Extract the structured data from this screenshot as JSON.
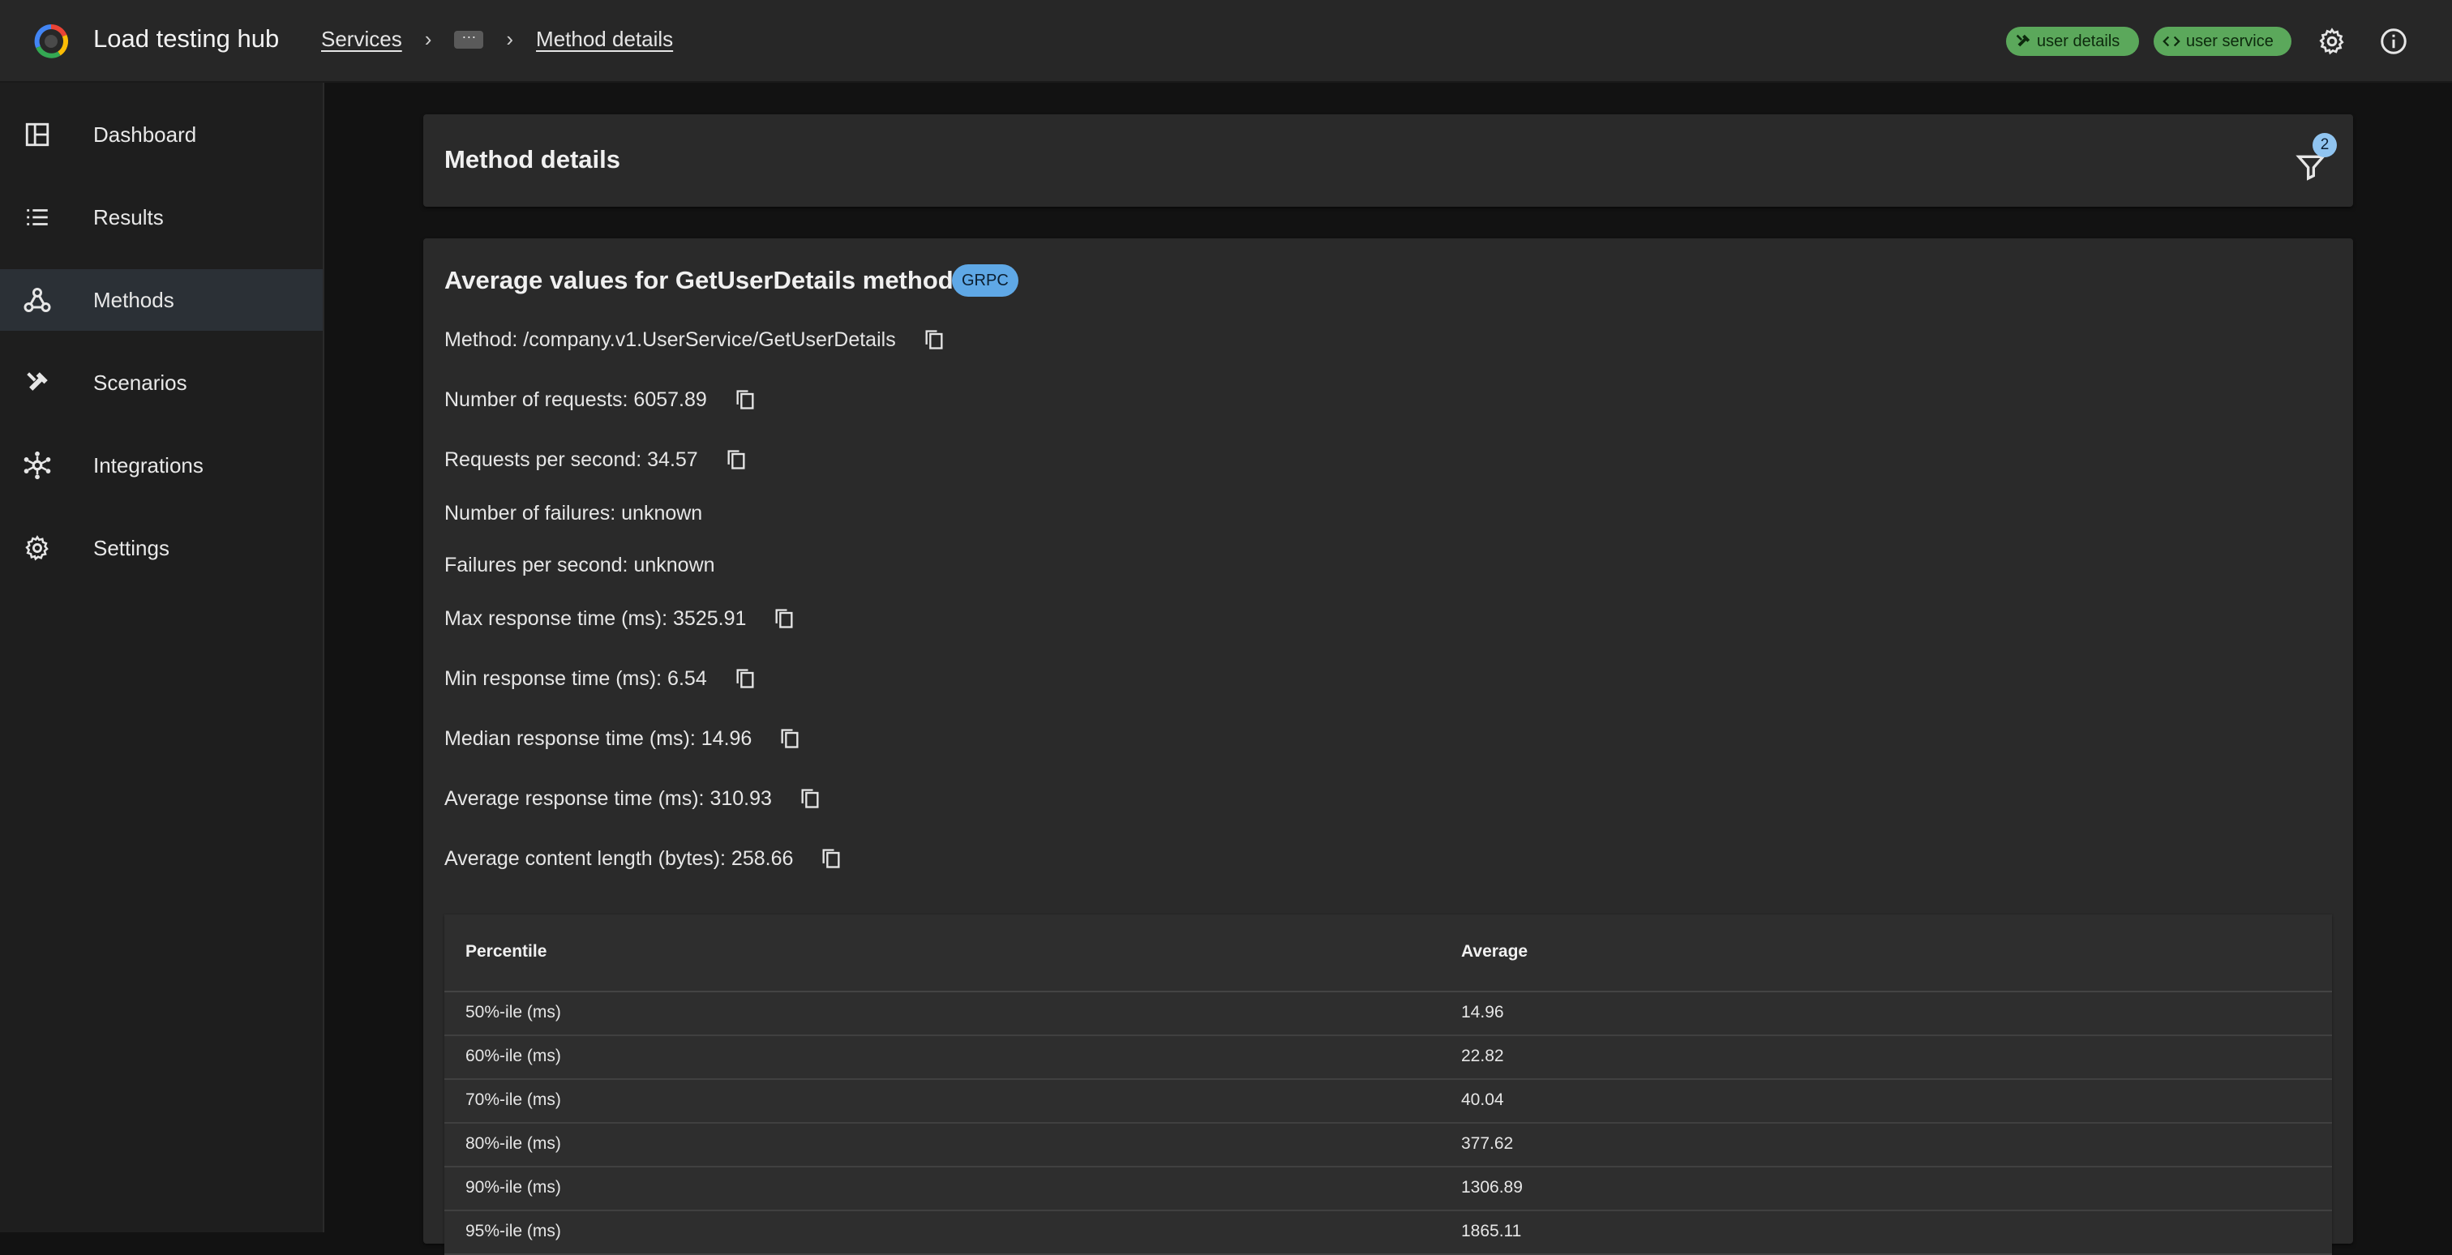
{
  "header": {
    "app_title": "Load testing hub",
    "breadcrumb": {
      "services": "Services",
      "ellipsis": "···",
      "current": "Method details"
    },
    "chips": [
      {
        "label": "user details",
        "icon": "tools-icon"
      },
      {
        "label": "user service",
        "icon": "code-icon"
      }
    ],
    "icons": [
      "gear-icon",
      "info-icon"
    ]
  },
  "sidebar": {
    "items": [
      {
        "label": "Dashboard",
        "icon": "dashboard-icon",
        "active": false
      },
      {
        "label": "Results",
        "icon": "list-icon",
        "active": false
      },
      {
        "label": "Methods",
        "icon": "webhook-icon",
        "active": true
      },
      {
        "label": "Scenarios",
        "icon": "tools-icon",
        "active": false
      },
      {
        "label": "Integrations",
        "icon": "hub-icon",
        "active": false
      },
      {
        "label": "Settings",
        "icon": "gear-icon",
        "active": false
      }
    ]
  },
  "method_details_card": {
    "title": "Method details",
    "filter_count": "2"
  },
  "averages": {
    "title": "Average values for GetUserDetails method",
    "badge": "GRPC",
    "stats": [
      {
        "text": "Method: /company.v1.UserService/GetUserDetails",
        "copy": true
      },
      {
        "text": "Number of requests: 6057.89",
        "copy": true
      },
      {
        "text": "Requests per second: 34.57",
        "copy": true
      },
      {
        "text": "Number of failures: unknown",
        "copy": false
      },
      {
        "text": "Failures per second: unknown",
        "copy": false
      },
      {
        "text": "Max response time (ms): 3525.91",
        "copy": true
      },
      {
        "text": "Min response time (ms): 6.54",
        "copy": true
      },
      {
        "text": "Median response time (ms): 14.96",
        "copy": true
      },
      {
        "text": "Average response time (ms): 310.93",
        "copy": true
      },
      {
        "text": "Average content length (bytes): 258.66",
        "copy": true
      }
    ]
  },
  "percentile_table": {
    "headers": [
      "Percentile",
      "Average"
    ],
    "rows": [
      [
        "50%-ile (ms)",
        "14.96"
      ],
      [
        "60%-ile (ms)",
        "22.82"
      ],
      [
        "70%-ile (ms)",
        "40.04"
      ],
      [
        "80%-ile (ms)",
        "377.62"
      ],
      [
        "90%-ile (ms)",
        "1306.89"
      ],
      [
        "95%-ile (ms)",
        "1865.11"
      ]
    ]
  },
  "colors": {
    "chip_green": "#5ba85b",
    "badge_blue": "#5fa8e6",
    "filter_badge": "#90c4f0",
    "active_nav": "#2b3036"
  }
}
